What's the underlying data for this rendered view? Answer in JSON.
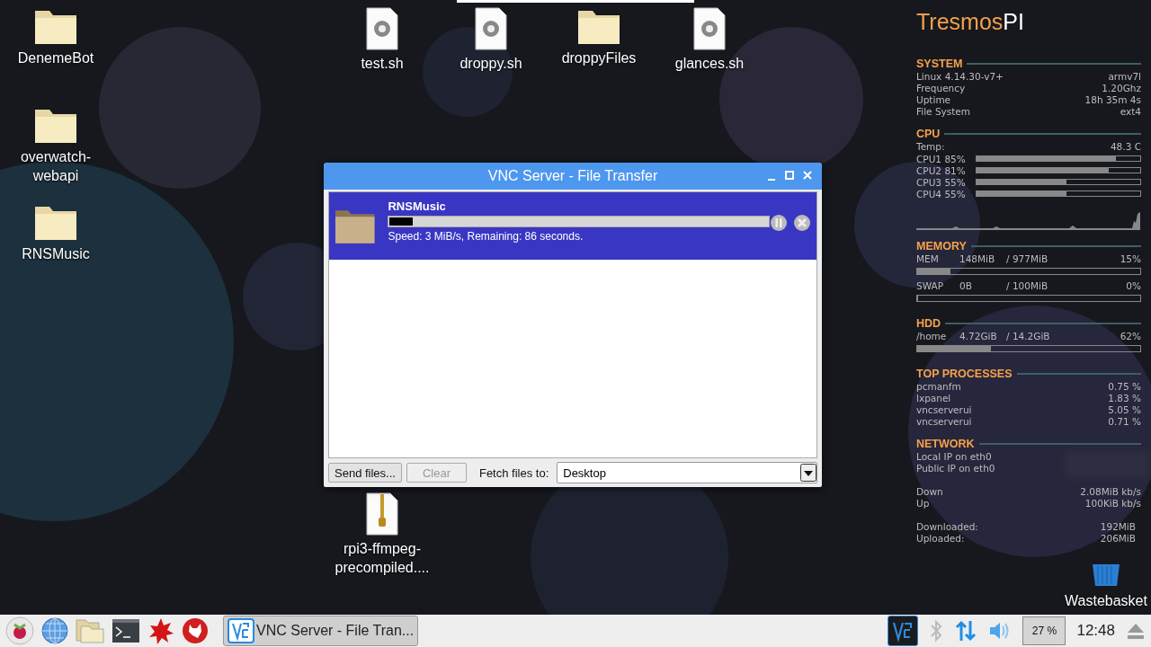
{
  "desktop_icons": [
    {
      "label": "DenemeBot",
      "kind": "folder"
    },
    {
      "label": "overwatch-webapi",
      "kind": "folder"
    },
    {
      "label": "RNSMusic",
      "kind": "folder"
    },
    {
      "label": "test.sh",
      "kind": "script"
    },
    {
      "label": "droppy.sh",
      "kind": "script"
    },
    {
      "label": "droppyFiles",
      "kind": "folder"
    },
    {
      "label": "glances.sh",
      "kind": "script"
    },
    {
      "label": "rpi3-ffmpeg-precompiled....",
      "kind": "archive"
    },
    {
      "label": "Wastebasket",
      "kind": "trash"
    }
  ],
  "window": {
    "title": "VNC Server - File Transfer",
    "transfer": {
      "name": "RNSMusic",
      "level": 0.06,
      "status": "Speed: 3 MiB/s, Remaining: 86 seconds."
    },
    "buttons": [
      {
        "label": "Send files...",
        "disabled": false
      },
      {
        "label": "Clear",
        "disabled": true
      }
    ],
    "fetch_label": "Fetch files to:",
    "fetch_value": "Desktop"
  },
  "conky": {
    "title": "Tresmos",
    "title_accent": "PI",
    "system": {
      "heading": "SYSTEM",
      "rows": [
        {
          "label": "Linux 4.14.30-v7+",
          "value": "armv7l"
        },
        {
          "label": "Frequency",
          "value": "1.20Ghz"
        },
        {
          "label": "Uptime",
          "value": "18h 35m 4s"
        },
        {
          "label": "File System",
          "value": "ext4"
        }
      ]
    },
    "cpu": {
      "heading": "CPU",
      "temp_label": "Temp:",
      "temp_value": "48.3 C",
      "cores": [
        {
          "label": "CPU1",
          "percent": "85%",
          "level": 0.85
        },
        {
          "label": "CPU2",
          "percent": "81%",
          "level": 0.81
        },
        {
          "label": "CPU3",
          "percent": "55%",
          "level": 0.55
        },
        {
          "label": "CPU4",
          "percent": "55%",
          "level": 0.55
        }
      ]
    },
    "memory": {
      "heading": "MEMORY",
      "rows": [
        {
          "label": "MEM",
          "used": "148MiB",
          "total": "/ 977MiB",
          "percent": "15%",
          "level": 0.15
        },
        {
          "label": "SWAP",
          "used": "0B",
          "total": "/ 100MiB",
          "percent": "0%",
          "level": 0
        }
      ]
    },
    "hdd": {
      "heading": "HDD",
      "rows": [
        {
          "label": "/home",
          "used": "4.72GiB",
          "total": "/ 14.2GiB",
          "percent": "62%",
          "level": 0.33
        }
      ]
    },
    "processes": {
      "heading": "TOP PROCESSES",
      "rows": [
        {
          "label": "pcmanfm",
          "value": "0.75 %"
        },
        {
          "label": "lxpanel",
          "value": "1.83 %"
        },
        {
          "label": "vncserverui",
          "value": "5.05 %"
        },
        {
          "label": "vncserverui",
          "value": "0.71 %"
        }
      ]
    },
    "network": {
      "heading": "NETWORK",
      "ip_rows": [
        {
          "label": "Local IP on eth0"
        },
        {
          "label": "Public IP on eth0"
        }
      ],
      "speed_rows": [
        {
          "label": "Down",
          "value": "2.08MiB kb/s"
        },
        {
          "label": "Up",
          "value": "100KiB  kb/s"
        }
      ],
      "total_rows": [
        {
          "label": "Downloaded:",
          "value": "192MiB"
        },
        {
          "label": "Uploaded:",
          "value": "206MiB"
        }
      ]
    }
  },
  "taskbar": {
    "launchers": [
      {
        "kind": "raspberry"
      },
      {
        "kind": "globe"
      },
      {
        "kind": "files"
      },
      {
        "kind": "terminal"
      },
      {
        "kind": "star"
      },
      {
        "kind": "wolf"
      }
    ],
    "task": {
      "label": "VNC Server - File Tran...",
      "selected": true
    },
    "tray": {
      "vnc_active": true,
      "cpu_reading": "27 %",
      "clock": "12:48"
    }
  }
}
